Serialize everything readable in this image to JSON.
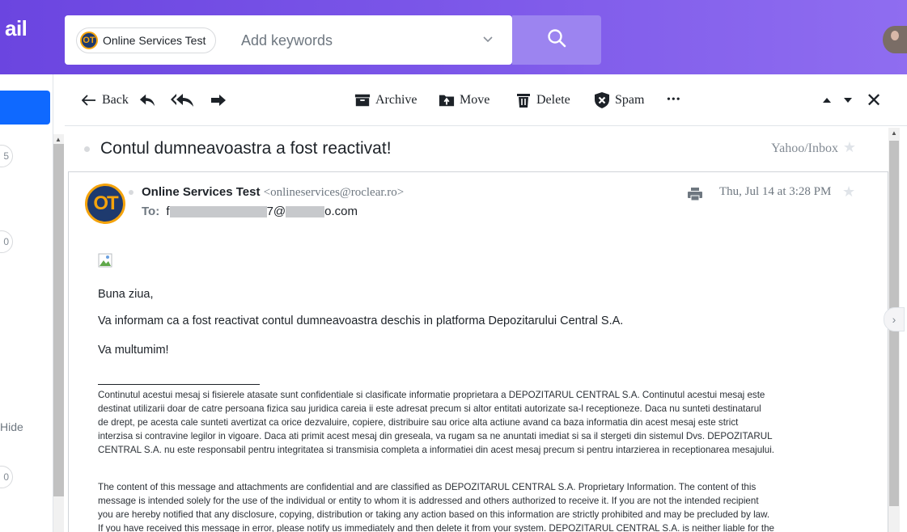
{
  "header": {
    "logo_fragment": "ail",
    "search": {
      "chip_initials": "OT",
      "chip_label": "Online Services Test",
      "placeholder": "Add keywords",
      "dropdown_icon": "chevron-down-icon",
      "search_icon": "search-icon"
    },
    "accent_color": "#6b45e0"
  },
  "sidebar": {
    "counts": [
      "5",
      "0",
      "0"
    ],
    "hide_fragment": "Hide"
  },
  "toolbar": {
    "back_label": "Back",
    "archive_label": "Archive",
    "move_label": "Move",
    "delete_label": "Delete",
    "spam_label": "Spam",
    "more_label": "•••",
    "close_label": "✕"
  },
  "message": {
    "subject": "Contul dumneavoastra a fost reactivat!",
    "folder": "Yahoo/Inbox",
    "sender_initials": "OT",
    "sender_name": "Online Services Test",
    "sender_email": "<onlineservices@roclear.ro>",
    "to_label": "To:",
    "to_address_start": "f",
    "to_address_mid": "7@",
    "to_address_end": "o.com",
    "date": "Thu, Jul 14 at 3:28 PM",
    "greeting": "Buna ziua,",
    "body": "Va informam ca a fost reactivat contul dumneavoastra deschis in platforma Depozitarului Central S.A.",
    "closing": "Va multumim!",
    "disclaimer_ro": [
      "Continutul acestui mesaj si fisierele atasate sunt confidentiale si clasificate informatie proprietara a DEPOZITARUL CENTRAL S.A. Continutul acestui mesaj este",
      "destinat utilizarii doar de catre persoana fizica sau juridica careia ii este adresat precum si altor entitati autorizate sa-l receptioneze. Daca nu sunteti destinatarul",
      "de drept, pe acesta cale sunteti avertizat ca orice dezvaluire, copiere, distribuire sau orice alta actiune avand ca baza informatia din acest mesaj este strict",
      "interzisa si contravine legilor in vigoare. Daca ati primit acest mesaj din greseala, va rugam sa ne anuntati imediat si sa il stergeti din sistemul Dvs. DEPOZITARUL",
      "CENTRAL S.A. nu este responsabil pentru integritatea si transmisia completa a informatiei din acest mesaj precum si pentru intarzierea in receptionarea mesajului."
    ],
    "disclaimer_en": [
      "The content of this message and attachments are confidential and are classified as DEPOZITARUL CENTRAL S.A. Proprietary Information. The content of this",
      "message is intended solely for the use of the individual or entity to whom it is addressed and others authorized to receive it. If you are not the intended recipient",
      "you are hereby notified that any disclosure, copying, distribution or taking any action based on this information are strictly prohibited and may be precluded by law.",
      "If you have received this message in error, please notify us immediately and then delete it from your system. DEPOZITARUL CENTRAL S.A. is neither liable for the"
    ]
  }
}
